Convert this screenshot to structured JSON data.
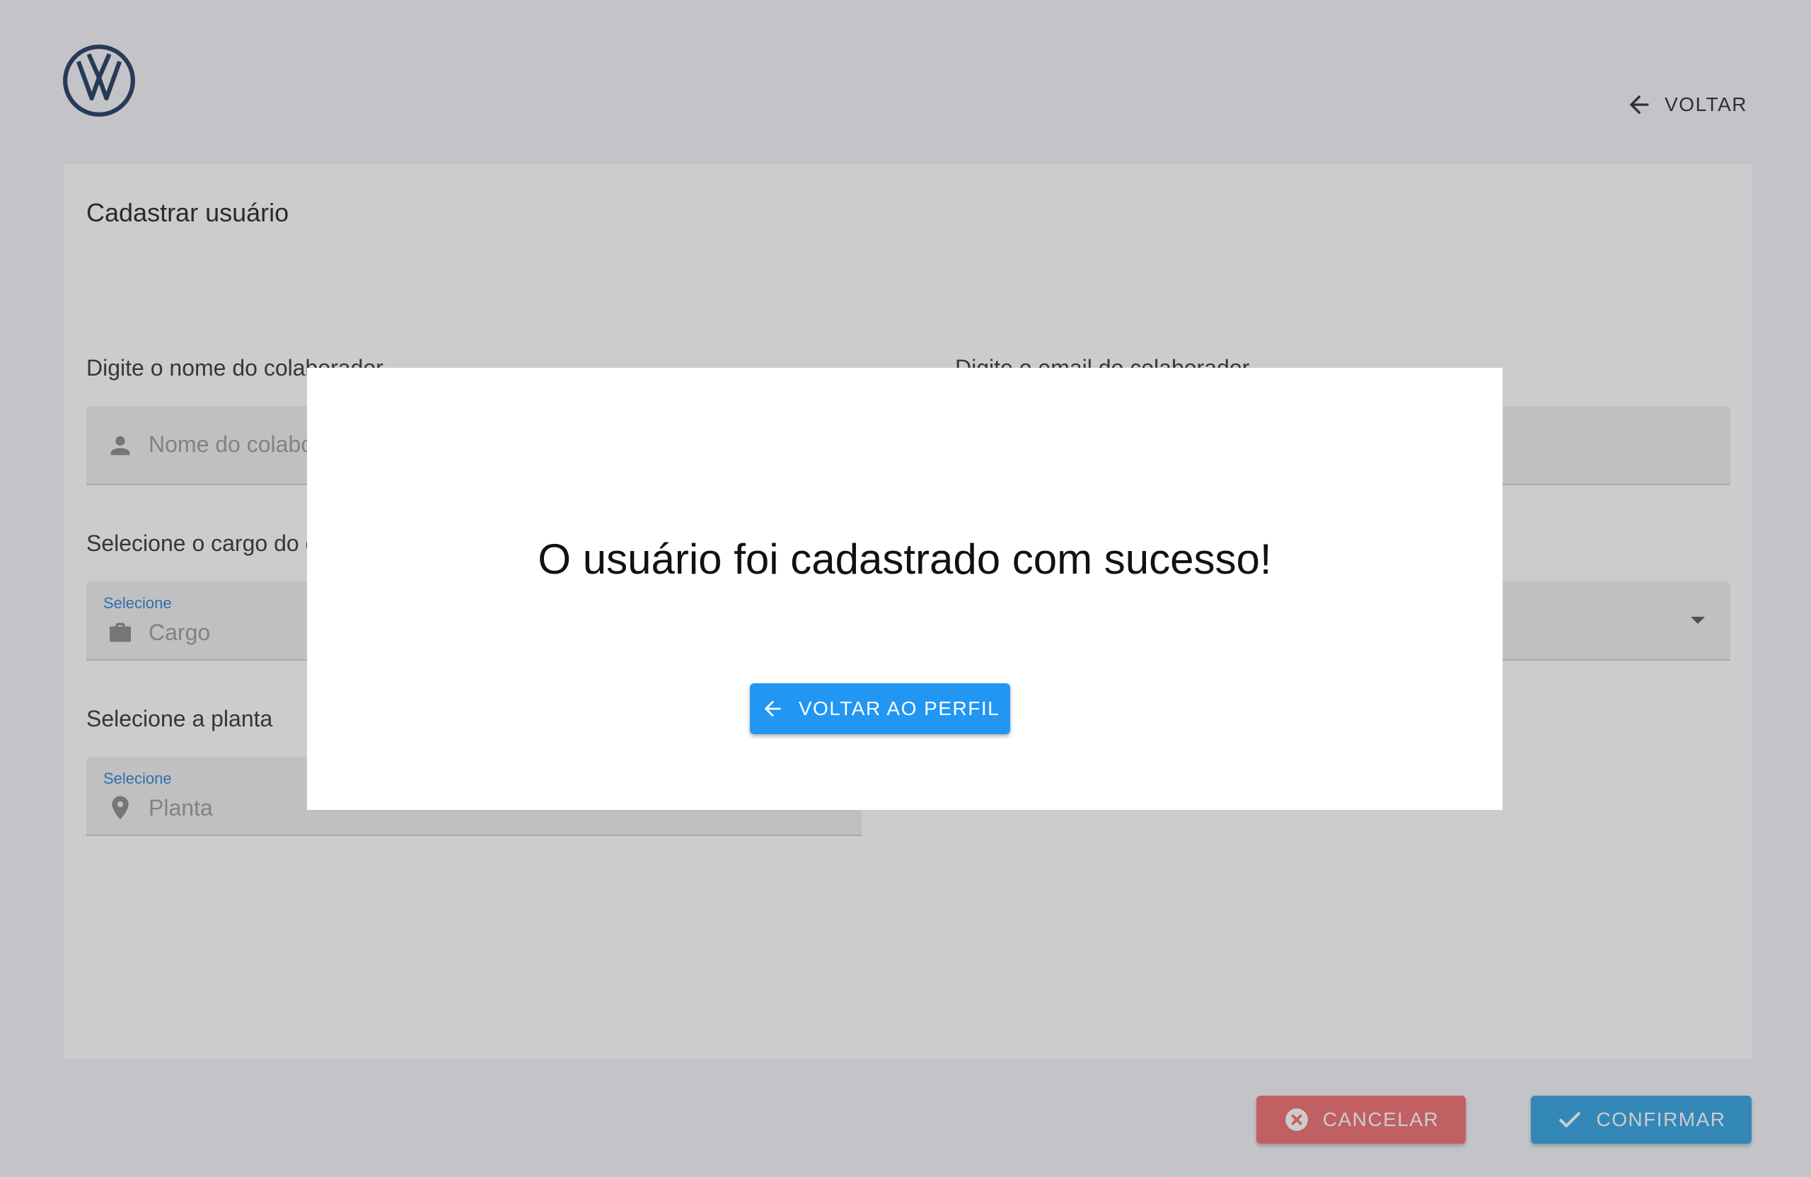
{
  "header": {
    "logo_icon": "vw-logo-icon",
    "back_label": "VOLTAR"
  },
  "form": {
    "title": "Cadastrar usuário",
    "name_label": "Digite o nome do colaborador",
    "name_placeholder": "Nome do colaborador",
    "email_label": "Digite o email do colaborador",
    "cargo_label": "Selecione o cargo do colaborador",
    "cargo_hint": "Selecione",
    "cargo_value": "Cargo",
    "planta_label": "Selecione a planta",
    "planta_hint": "Selecione",
    "planta_value": "Planta"
  },
  "actions": {
    "cancel_label": "CANCELAR",
    "confirm_label": "CONFIRMAR"
  },
  "modal": {
    "message": "O usuário foi cadastrado com sucesso!",
    "button_label": "VOLTAR AO PERFIL"
  },
  "colors": {
    "background": "#f4f5f7",
    "logo": "#1e3a5f",
    "cancel": "#f16b6b",
    "confirm": "#2fa3e0",
    "modal_button": "#2196f3"
  }
}
